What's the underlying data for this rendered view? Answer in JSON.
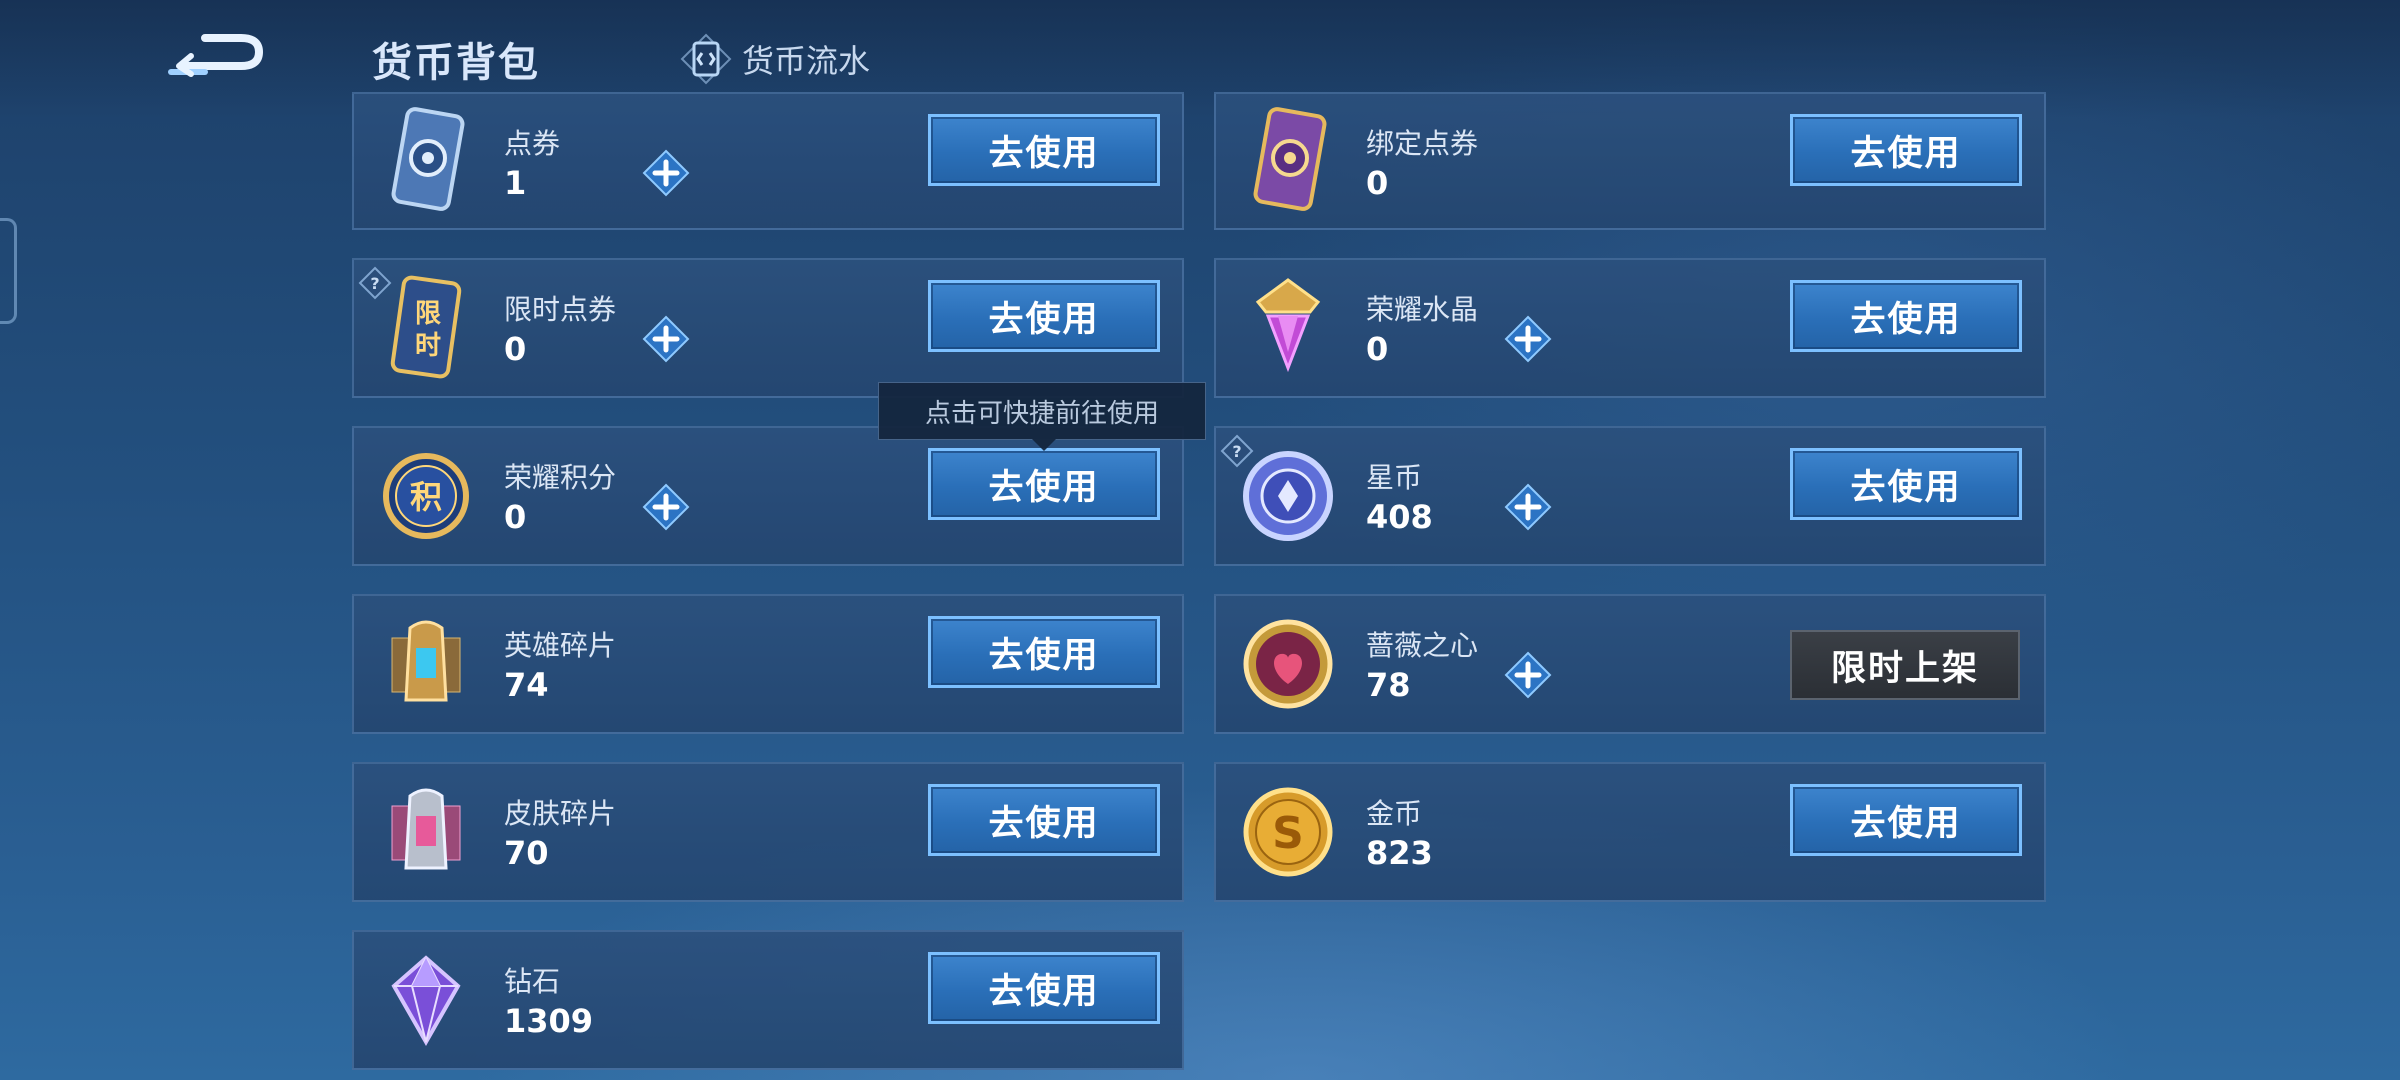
{
  "header": {
    "title": "货币背包",
    "flow_tab_label": "货币流水"
  },
  "tooltip": "点击可快捷前往使用",
  "colors": {
    "accent": "#7cc0ff",
    "button_fill": "#2a6fb8",
    "card_bg": "#2b507d"
  },
  "currencies": [
    {
      "name": "点券",
      "count": "1",
      "icon": "coupon-icon",
      "has_plus": true,
      "action": "去使用"
    },
    {
      "name": "绑定点券",
      "count": "0",
      "icon": "bound-coupon-icon",
      "has_plus": false,
      "action": "去使用"
    },
    {
      "name": "限时点券",
      "count": "0",
      "icon": "limited-coupon-icon",
      "has_plus": true,
      "action": "去使用",
      "help": true
    },
    {
      "name": "荣耀水晶",
      "count": "0",
      "icon": "glory-crystal-icon",
      "has_plus": true,
      "action": "去使用"
    },
    {
      "name": "荣耀积分",
      "count": "0",
      "icon": "glory-points-icon",
      "has_plus": true,
      "action": "去使用"
    },
    {
      "name": "星币",
      "count": "408",
      "icon": "star-coin-icon",
      "has_plus": true,
      "action": "去使用",
      "help": true
    },
    {
      "name": "英雄碎片",
      "count": "74",
      "icon": "hero-fragment-icon",
      "has_plus": false,
      "action": "去使用"
    },
    {
      "name": "蔷薇之心",
      "count": "78",
      "icon": "rose-heart-icon",
      "has_plus": true,
      "action": "限时上架"
    },
    {
      "name": "皮肤碎片",
      "count": "70",
      "icon": "skin-fragment-icon",
      "has_plus": false,
      "action": "去使用"
    },
    {
      "name": "金币",
      "count": "823",
      "icon": "gold-coin-icon",
      "has_plus": false,
      "action": "去使用"
    },
    {
      "name": "钻石",
      "count": "1309",
      "icon": "diamond-icon",
      "has_plus": false,
      "action": "去使用"
    }
  ]
}
